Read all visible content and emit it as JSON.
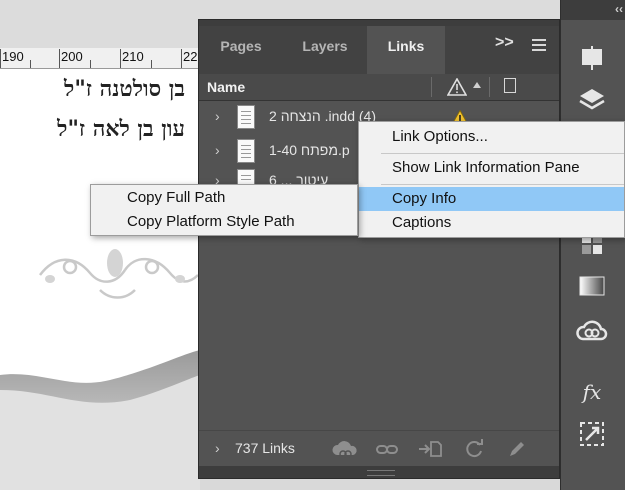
{
  "window": {
    "accent_color": "#90c8f6",
    "panel_bg": "#535353"
  },
  "canvas": {
    "ruler_ticks": [
      "190",
      "200",
      "210",
      "22"
    ],
    "hebrew_line1": "בן סולטנה ז\"ל",
    "hebrew_line2": "עון בן לאה ז\"ל"
  },
  "panel": {
    "tabs": [
      {
        "label": "Pages"
      },
      {
        "label": "Layers"
      },
      {
        "label": "Links",
        "active": true
      }
    ],
    "expand_label": ">>",
    "column_name": "Name",
    "rows": [
      {
        "name": "2 הנצחה .indd (4)",
        "warning": true
      },
      {
        "name": "1-40 מפתח.p"
      },
      {
        "name": "6 ... עיטור"
      }
    ],
    "footer_count": "737 Links",
    "footer_icons": [
      "cloud-link-icon",
      "relink-icon",
      "go-to-link-icon",
      "update-link-icon",
      "edit-original-icon"
    ]
  },
  "toolstrip": {
    "collapse_label": "‹‹",
    "icons": [
      "pages-icon",
      "layers-icon",
      "links-icon",
      "swatches-icon",
      "gradient-icon",
      "cc-libraries-icon",
      "effects-icon",
      "transform-icon"
    ],
    "fx_label": "fx"
  },
  "context_menu": {
    "items": [
      {
        "label": "Link Options..."
      },
      {
        "label": "Show Link Information Pane"
      },
      {
        "label": "Copy Info",
        "highlighted": true
      },
      {
        "label": "Captions"
      }
    ]
  },
  "submenu": {
    "items": [
      {
        "label": "Copy Full Path"
      },
      {
        "label": "Copy Platform Style Path"
      }
    ]
  }
}
